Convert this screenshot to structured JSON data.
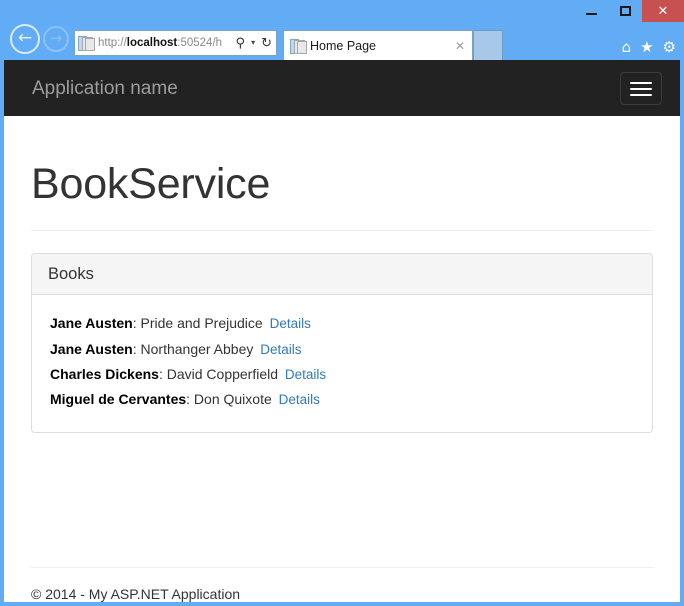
{
  "window": {
    "minimize_label": "–",
    "maximize_label": "□",
    "close_label": "✕"
  },
  "browser": {
    "back_label": "←",
    "forward_label": "→",
    "address": {
      "scheme": "http://",
      "host": "localhost",
      "rest": ":50524/h",
      "full": "http://localhost:50524/h",
      "search_icon": "⚲",
      "caret_icon": "▾",
      "refresh_icon": "↻"
    },
    "tab": {
      "title": "Home Page",
      "close_label": "✕"
    },
    "new_tab_label": "",
    "toolbar": {
      "home_icon": "⌂",
      "favorites_icon": "★",
      "settings_icon": "⚙"
    }
  },
  "page": {
    "navbar": {
      "brand": "Application name",
      "toggle_label": "Toggle navigation"
    },
    "title": "BookService",
    "panel": {
      "heading": "Books",
      "books": [
        {
          "author": "Jane Austen",
          "separator": ":",
          "title": "Pride and Prejudice",
          "details_label": "Details"
        },
        {
          "author": "Jane Austen",
          "separator": ":",
          "title": "Northanger Abbey",
          "details_label": "Details"
        },
        {
          "author": "Charles Dickens",
          "separator": ":",
          "title": "David Copperfield",
          "details_label": "Details"
        },
        {
          "author": "Miguel de Cervantes",
          "separator": ":",
          "title": "Don Quixote",
          "details_label": "Details"
        }
      ]
    },
    "footer": {
      "copyright": "© 2014 - My ASP.NET Application"
    }
  },
  "colors": {
    "window_frame": "#62abf5",
    "navbar_bg": "#222222",
    "brand_text": "#9d9d9d",
    "link_blue": "#337ab7",
    "panel_heading_bg": "#f5f5f5",
    "panel_border": "#dddddd",
    "close_button_bg": "#c75050"
  }
}
